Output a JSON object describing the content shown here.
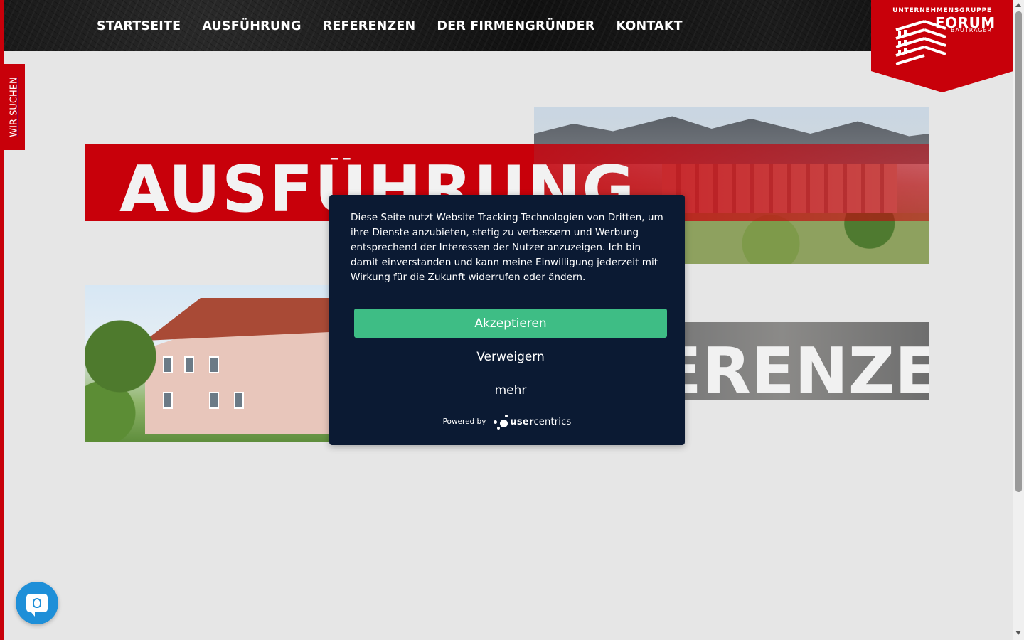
{
  "nav": {
    "items": [
      {
        "label": "STARTSEITE"
      },
      {
        "label": "AUSFÜHRUNG"
      },
      {
        "label": "REFERENZEN"
      },
      {
        "label": "DER FIRMENGRÜNDER"
      },
      {
        "label": "KONTAKT"
      }
    ]
  },
  "logo": {
    "top_text": "UNTERNEHMENSGRUPPE",
    "brand": "FORUM",
    "sub": "BAUTRÄGER"
  },
  "side_tab": {
    "label": "WIR SUCHEN"
  },
  "content": {
    "title_ausfuehrung": "AUSFÜHRUNG",
    "title_referenzen": "REFERENZEN"
  },
  "consent": {
    "text": "Diese Seite nutzt Website Tracking-Technologien von Dritten, um ihre Dienste anzubieten, stetig zu verbessern und Werbung entsprechend der Interessen der Nutzer anzuzeigen. Ich bin damit einverstanden und kann meine Einwilligung jederzeit mit Wirkung für die Zukunft widerrufen oder ändern.",
    "accept_label": "Akzeptieren",
    "deny_label": "Verweigern",
    "more_label": "mehr",
    "powered_by": "Powered by",
    "brand_bold": "user",
    "brand_rest": "centrics"
  },
  "colors": {
    "brand_red": "#c8000a",
    "consent_bg": "#0b1a33",
    "accept_green": "#3ebd85",
    "privacy_blue": "#1e8fd8"
  },
  "icons": {
    "privacy": "fingerprint-chat-icon",
    "usercentrics": "usercentrics-dots-logo"
  }
}
